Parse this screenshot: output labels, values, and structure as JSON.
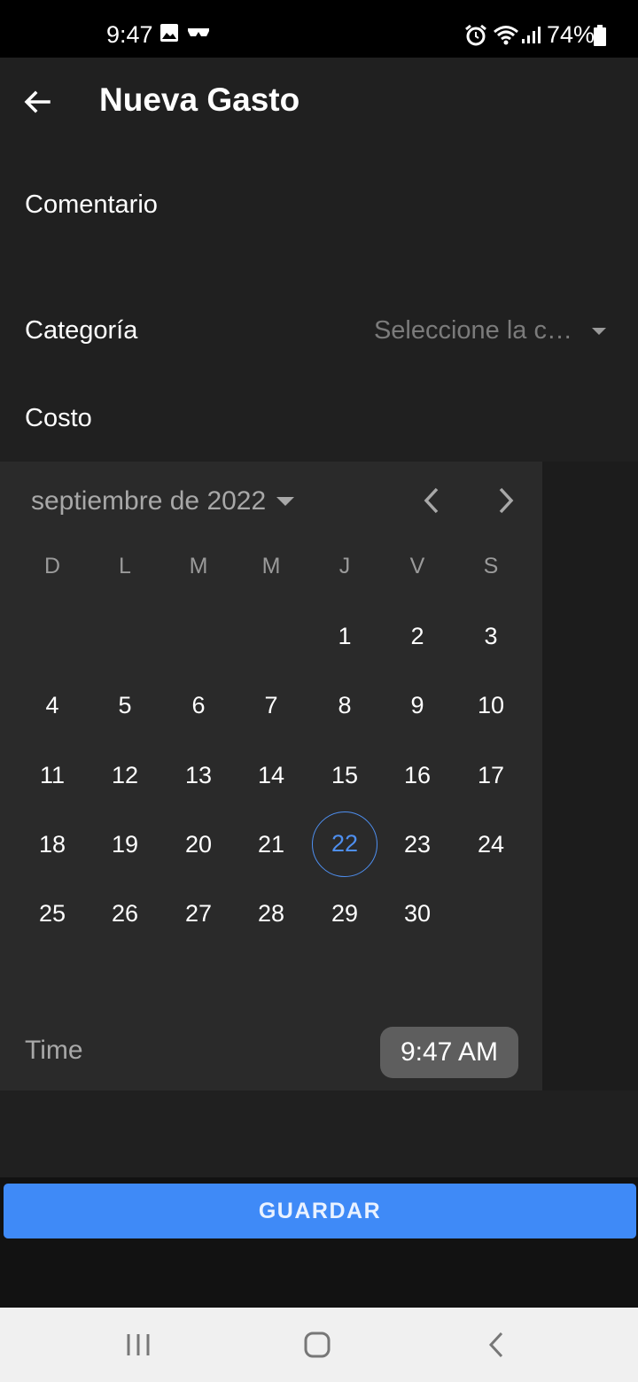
{
  "status_bar": {
    "time": "9:47",
    "battery": "74%"
  },
  "app_bar": {
    "title": "Nueva Gasto"
  },
  "form": {
    "comment_label": "Comentario",
    "category_label": "Categoría",
    "category_placeholder": "Seleccione la c…",
    "cost_label": "Costo"
  },
  "date_picker": {
    "month_label": "septiembre de 2022",
    "weekdays": [
      "D",
      "L",
      "M",
      "M",
      "J",
      "V",
      "S"
    ],
    "days": [
      "1",
      "2",
      "3",
      "4",
      "5",
      "6",
      "7",
      "8",
      "9",
      "10",
      "11",
      "12",
      "13",
      "14",
      "15",
      "16",
      "17",
      "18",
      "19",
      "20",
      "21",
      "22",
      "23",
      "24",
      "25",
      "26",
      "27",
      "28",
      "29",
      "30"
    ],
    "today": "22",
    "time_label": "Time",
    "time_value": "9:47 AM"
  },
  "actions": {
    "save_label": "GUARDAR"
  },
  "colors": {
    "accent": "#3f8af7",
    "today": "#4e8ff0"
  }
}
